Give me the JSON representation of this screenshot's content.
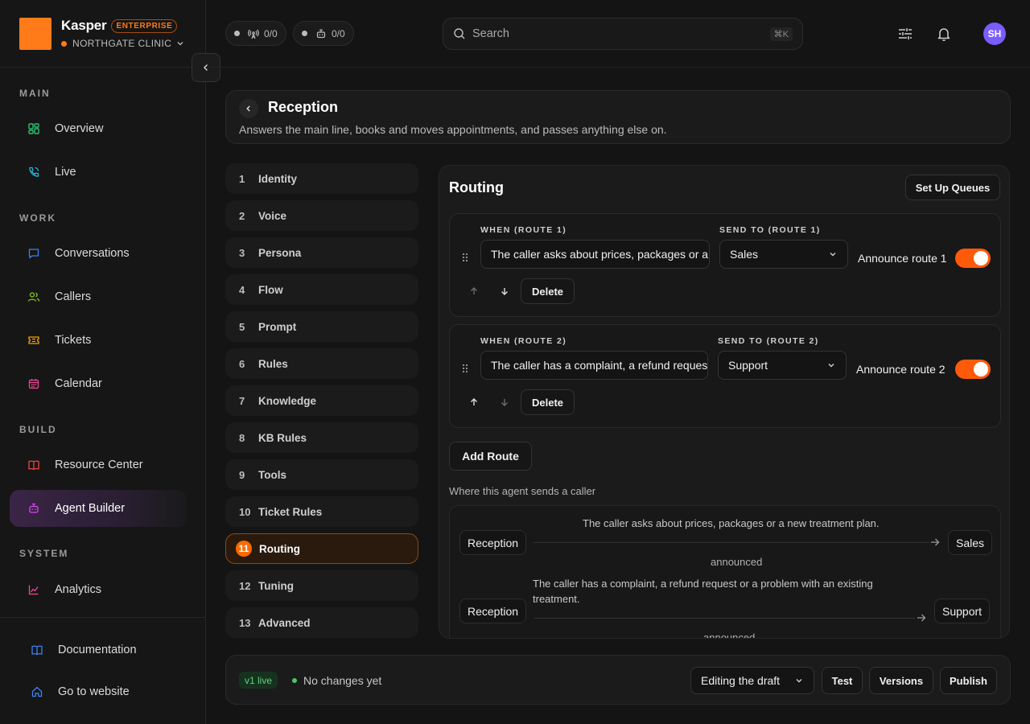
{
  "brand": {
    "name": "Kasper",
    "badge": "ENTERPRISE",
    "org": "NORTHGATE CLINIC",
    "accent": "#ff7a18"
  },
  "topbar": {
    "counters": [
      {
        "icon": "antenna-icon",
        "value": "0/0"
      },
      {
        "icon": "robot-icon",
        "value": "0/0"
      }
    ],
    "search": {
      "placeholder": "Search",
      "shortcut": "⌘K"
    },
    "avatar_initials": "SH"
  },
  "sidebar": {
    "sections": {
      "main": "MAIN",
      "work": "WORK",
      "build": "BUILD",
      "system": "SYSTEM"
    },
    "items": [
      {
        "label": "Overview",
        "icon": "grid-icon",
        "color": "#2fbf71"
      },
      {
        "label": "Live",
        "icon": "phone-icon",
        "color": "#2ab3d6"
      },
      {
        "label": "Conversations",
        "icon": "chat-icon",
        "color": "#3b82f6"
      },
      {
        "label": "Callers",
        "icon": "users-icon",
        "color": "#84cc16"
      },
      {
        "label": "Tickets",
        "icon": "ticket-icon",
        "color": "#f59e0b"
      },
      {
        "label": "Calendar",
        "icon": "calendar-icon",
        "color": "#ec4899"
      },
      {
        "label": "Resource Center",
        "icon": "book-icon",
        "color": "#ef4444"
      },
      {
        "label": "Agent Builder",
        "icon": "robot-icon",
        "color": "#d946ef"
      },
      {
        "label": "Analytics",
        "icon": "chart-icon",
        "color": "#ec4899"
      }
    ],
    "bottom": [
      {
        "label": "Documentation",
        "icon": "book-icon",
        "color": "#3b82f6"
      },
      {
        "label": "Go to website",
        "icon": "home-icon",
        "color": "#3b82f6"
      }
    ]
  },
  "header": {
    "title": "Reception",
    "subtitle": "Answers the main line, books and moves appointments, and passes anything else on."
  },
  "steps": [
    {
      "num": "1",
      "label": "Identity"
    },
    {
      "num": "2",
      "label": "Voice"
    },
    {
      "num": "3",
      "label": "Persona"
    },
    {
      "num": "4",
      "label": "Flow"
    },
    {
      "num": "5",
      "label": "Prompt"
    },
    {
      "num": "6",
      "label": "Rules"
    },
    {
      "num": "7",
      "label": "Knowledge"
    },
    {
      "num": "8",
      "label": "KB Rules"
    },
    {
      "num": "9",
      "label": "Tools"
    },
    {
      "num": "10",
      "label": "Ticket Rules"
    },
    {
      "num": "11",
      "label": "Routing"
    },
    {
      "num": "12",
      "label": "Tuning"
    },
    {
      "num": "13",
      "label": "Advanced"
    }
  ],
  "routing": {
    "title": "Routing",
    "setup_label": "Set Up Queues",
    "routes": [
      {
        "when_label": "WHEN (ROUTE 1)",
        "when_value": "The caller asks about prices, packages or a new treatment plan.",
        "send_label": "SEND TO (ROUTE 1)",
        "send_value": "Sales",
        "announce_label": "Announce route 1",
        "announce_on": true,
        "delete_label": "Delete"
      },
      {
        "when_label": "WHEN (ROUTE 2)",
        "when_value": "The caller has a complaint, a refund request or a problem with an existing treatment.",
        "send_label": "SEND TO (ROUTE 2)",
        "send_value": "Support",
        "announce_label": "Announce route 2",
        "announce_on": true,
        "delete_label": "Delete"
      }
    ],
    "add_route_label": "Add Route",
    "map_label": "Where this agent sends a caller",
    "map": [
      {
        "from": "Reception",
        "condition": "The caller asks about prices, packages or a new treatment plan.",
        "to": "Sales",
        "note": "announced"
      },
      {
        "from": "Reception",
        "condition": "The caller has a complaint, a refund request or a problem with an existing treatment.",
        "to": "Support",
        "note": "announced"
      }
    ]
  },
  "footer": {
    "version_badge": "v1 live",
    "status": "No changes yet",
    "mode_select": "Editing the draft",
    "test_label": "Test",
    "versions_label": "Versions",
    "publish_label": "Publish"
  }
}
